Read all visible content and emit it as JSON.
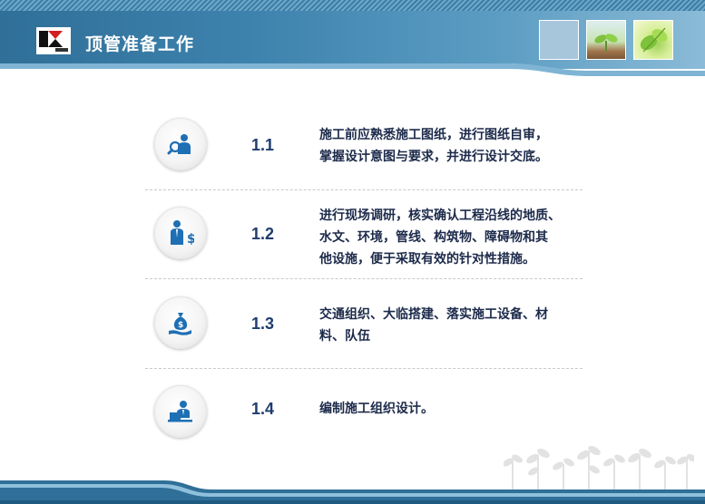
{
  "header": {
    "title": "顶管准备工作"
  },
  "items": [
    {
      "number": "1.1",
      "icon": "magnifier-person-icon",
      "line1": "施工前应熟悉施工图纸，进行图纸自审，",
      "line2": "掌握设计意图与要求，并进行设计交底。",
      "line3": ""
    },
    {
      "number": "1.2",
      "icon": "businessman-dollar-icon",
      "line1": "进行现场调研，核实确认工程沿线的地质、",
      "line2": "水文、环境，管线、构筑物、障碍物和其",
      "line3": "他设施，便于采取有效的针对性措施。"
    },
    {
      "number": "1.3",
      "icon": "money-bag-hand-icon",
      "line1": "交通组织、大临搭建、落实施工设备、材",
      "line2": "料、队伍",
      "line3": ""
    },
    {
      "number": "1.4",
      "icon": "person-laptop-icon",
      "line1": "编制施工组织设计。",
      "line2": "",
      "line3": ""
    }
  ],
  "colors": {
    "header_blue": "#2f6f98",
    "icon_blue": "#1f6fb4",
    "number_navy": "#1f3d6e",
    "text_navy": "#1c2a4a"
  }
}
